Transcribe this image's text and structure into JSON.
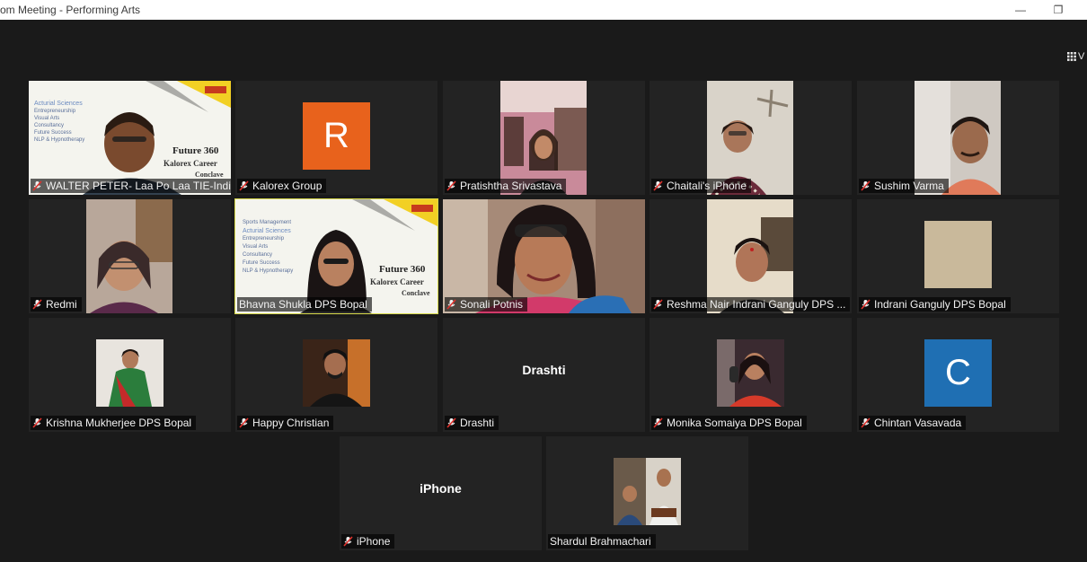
{
  "window": {
    "title": "om Meeting - Performing Arts",
    "minimize_glyph": "—",
    "restore_glyph": "❐"
  },
  "view_button": {
    "icon": "grid-icon",
    "label": "V"
  },
  "participants": [
    {
      "name": "WALTER PETER- Laa Po Laa TIE-India",
      "muted": true
    },
    {
      "name": "Kalorex Group",
      "muted": true,
      "initial": "R",
      "color": "#e8621c"
    },
    {
      "name": "Pratishtha Srivastava",
      "muted": true
    },
    {
      "name": "Chaitali's iPhone",
      "muted": true
    },
    {
      "name": "Sushim Varma",
      "muted": true
    },
    {
      "name": "Redmi",
      "muted": true
    },
    {
      "name": "Bhavna Shukla DPS Bopal",
      "muted": false,
      "active_speaker": true
    },
    {
      "name": "Sonali Potnis",
      "muted": true
    },
    {
      "name": "Reshma Nair Indrani Ganguly DPS ...",
      "muted": true
    },
    {
      "name": "Indrani Ganguly DPS Bopal",
      "muted": true
    },
    {
      "name": "Krishna Mukherjee DPS Bopal",
      "muted": true
    },
    {
      "name": "Happy Christian",
      "muted": true
    },
    {
      "name": "Drashti",
      "muted": true,
      "display_text": "Drashti"
    },
    {
      "name": "Monika Somaiya DPS Bopal",
      "muted": true
    },
    {
      "name": "Chintan Vasavada",
      "muted": true,
      "initial": "C",
      "color": "#1f6fb3"
    },
    {
      "name": "iPhone",
      "muted": true,
      "display_text": "iPhone"
    },
    {
      "name": "Shardul Brahmachari",
      "muted": false
    }
  ],
  "poster": {
    "brand": "Kalorex",
    "line1": "Future 360",
    "line2": "Kalorex Career",
    "line3": "Conclave",
    "topics": [
      "Acturial Sciences",
      "Visual Arts",
      "Consultancy",
      "Future Success",
      "NLP & Hypnotherapy",
      "Entrepreneurship",
      "Sports Management"
    ],
    "accent": "#f2d024"
  },
  "colors": {
    "active_border": "#d7d94a",
    "muted_icon": "#e0322d"
  }
}
